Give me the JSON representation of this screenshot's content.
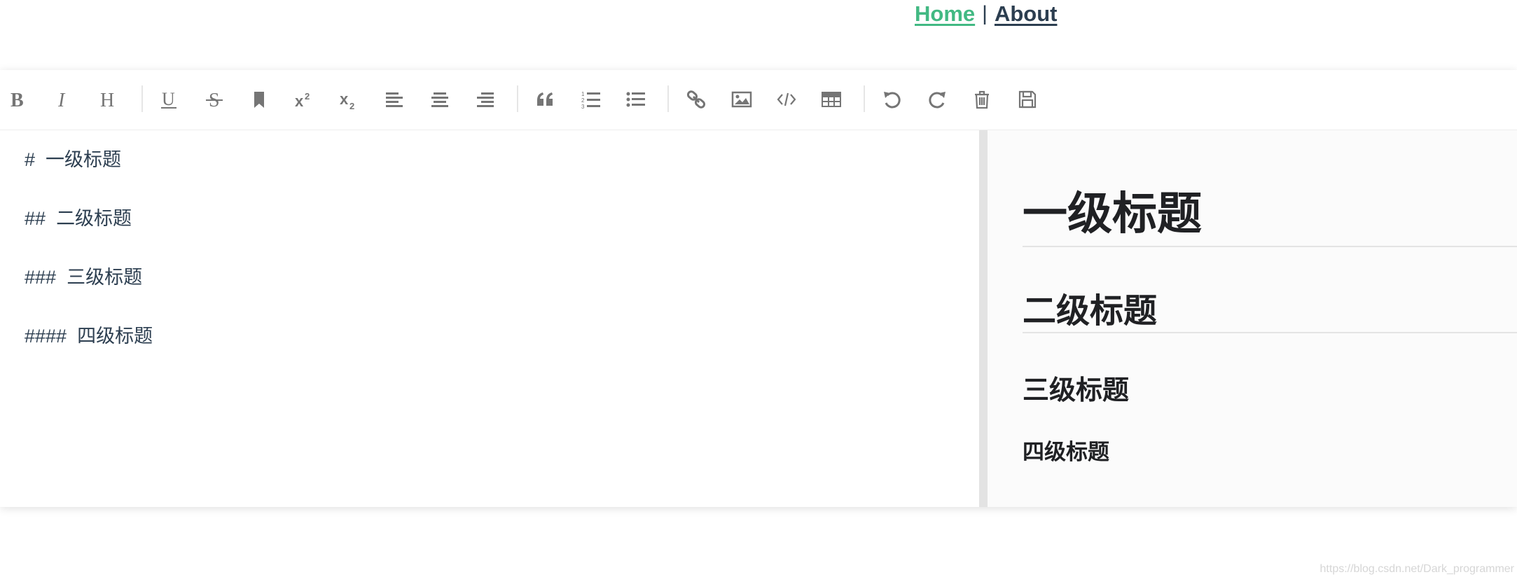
{
  "nav": {
    "home": "Home",
    "separator": "|",
    "about": "About"
  },
  "toolbar": {
    "tooltips": {
      "bold": "B",
      "italic": "I",
      "heading": "H",
      "underline": "U",
      "superscript": "x²",
      "subscript": "x₂"
    }
  },
  "editor": {
    "source_lines": [
      {
        "marker": "#",
        "text": "一级标题"
      },
      {
        "marker": "##",
        "text": "二级标题"
      },
      {
        "marker": "###",
        "text": "三级标题"
      },
      {
        "marker": "####",
        "text": "四级标题"
      }
    ]
  },
  "preview": {
    "h1": "一级标题",
    "h2": "二级标题",
    "h3": "三级标题",
    "h4": "四级标题"
  },
  "watermark": "https://blog.csdn.net/Dark_programmer",
  "colors": {
    "accent": "#42b983",
    "text": "#2c3e50",
    "icon": "#757575"
  }
}
